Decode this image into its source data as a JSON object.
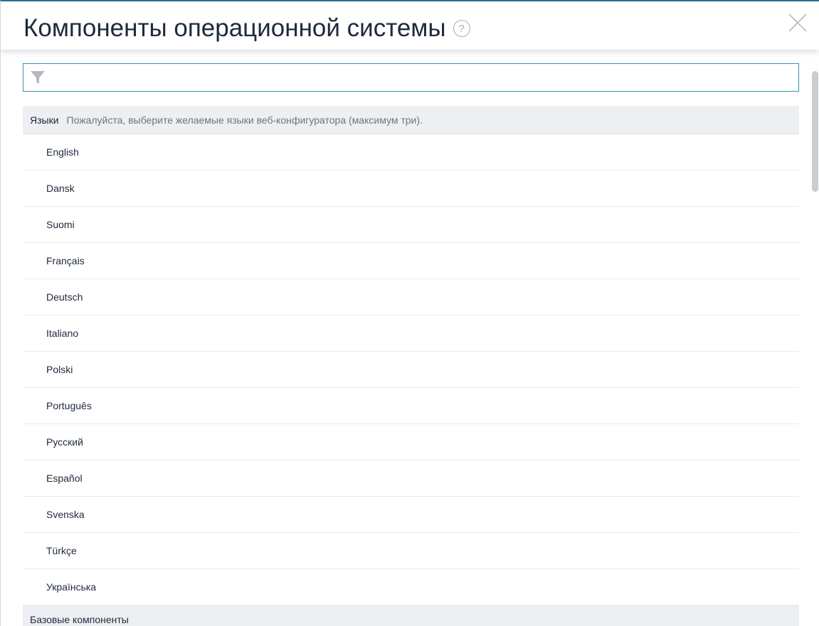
{
  "header": {
    "title": "Компоненты операционной системы",
    "help_symbol": "?"
  },
  "filter": {
    "value": "",
    "placeholder": ""
  },
  "sections": [
    {
      "title": "Языки",
      "description": "Пожалуйста, выберите желаемые языки веб-конфигуратора (максимум три).",
      "items": [
        "English",
        "Dansk",
        "Suomi",
        "Français",
        "Deutsch",
        "Italiano",
        "Polski",
        "Português",
        "Русский",
        "Español",
        "Svenska",
        "Türkçe",
        "Українська"
      ]
    },
    {
      "title": "Базовые компоненты",
      "description": "",
      "items": []
    }
  ],
  "colors": {
    "accent": "#3c8fa8",
    "section_bg": "#edeff2",
    "text": "#1e2a3a",
    "muted_text": "#6b7683"
  },
  "icons": {
    "help": "help-circle-icon",
    "close": "close-icon",
    "filter": "filter-funnel-icon"
  }
}
